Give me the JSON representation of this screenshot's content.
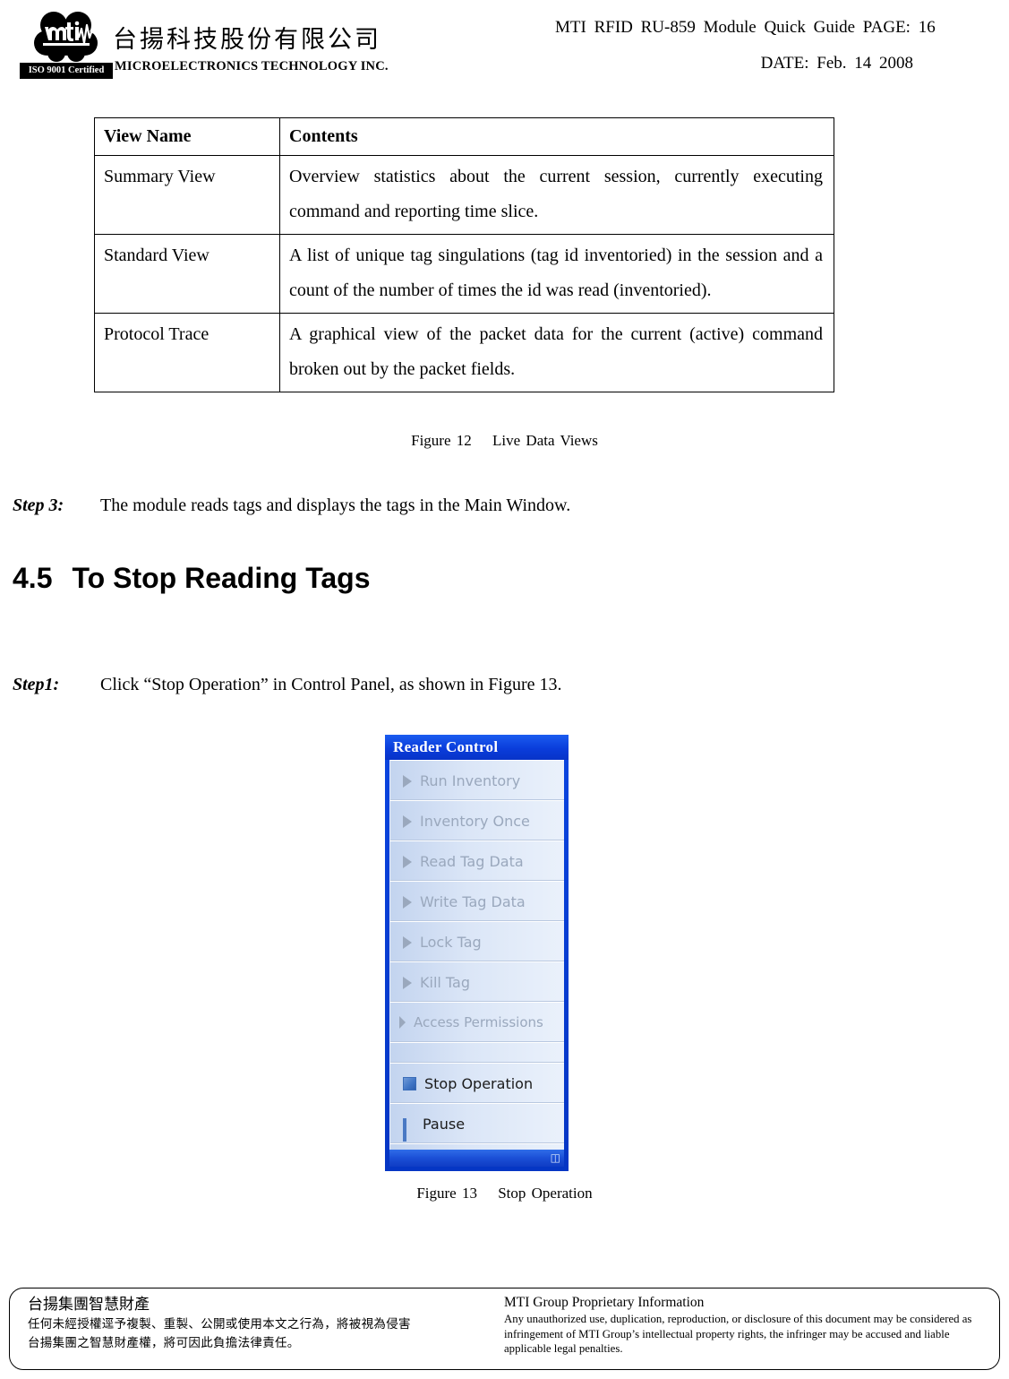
{
  "header": {
    "company_cn": "台揚科技股份有限公司",
    "company_en": "MICROELECTRONICS TECHNOLOGY INC.",
    "iso_badge": "ISO 9001 Certified",
    "doc_title": "MTI  RFID  RU-859  Module  Quick  Guide   PAGE:  16",
    "doc_date": "DATE:  Feb.  14  2008"
  },
  "views_table": {
    "headers": [
      "View Name",
      "Contents"
    ],
    "rows": [
      {
        "name": "Summary View",
        "contents": "Overview statistics about the current session, currently executing command and reporting time slice."
      },
      {
        "name": "Standard View",
        "contents": "A list of unique tag singulations (tag id inventoried) in the session and a count of the number of times the id was read (inventoried)."
      },
      {
        "name": "Protocol Trace",
        "contents": "A graphical view of the packet data for the current (active) command broken out by the packet fields."
      }
    ]
  },
  "captions": {
    "figure_12": "Figure 12　 Live Data Views",
    "figure_13": "Figure 13　 Stop Operation"
  },
  "steps": {
    "step3_label": "Step 3:",
    "step3_text": "The module reads tags and displays the tags in the Main Window.",
    "step1_label": "Step1:",
    "step1_text": "Click “Stop Operation” in Control Panel, as shown in Figure 13."
  },
  "section": {
    "number": "4.5",
    "title": "To Stop Reading Tags"
  },
  "reader_control": {
    "title": "Reader Control",
    "items": [
      {
        "label": "Run Inventory",
        "icon": "arrow-right-icon",
        "enabled": false
      },
      {
        "label": "Inventory Once",
        "icon": "arrow-right-icon",
        "enabled": false
      },
      {
        "label": "Read Tag Data",
        "icon": "arrow-right-icon",
        "enabled": false
      },
      {
        "label": "Write Tag Data",
        "icon": "arrow-right-icon",
        "enabled": false
      },
      {
        "label": "Lock Tag",
        "icon": "arrow-right-icon",
        "enabled": false
      },
      {
        "label": "Kill Tag",
        "icon": "arrow-right-icon",
        "enabled": false
      },
      {
        "label": "Access Permissions",
        "icon": "arrow-right-icon",
        "enabled": false
      },
      {
        "label": "Stop Operation",
        "icon": "stop-square-icon",
        "enabled": true
      },
      {
        "label": "Pause",
        "icon": "pause-bars-icon",
        "enabled": true
      }
    ],
    "grip_icon": "resize-grip-icon",
    "colors": {
      "titlebar": "#0a3ddb",
      "panel_border": "#0b3fd4",
      "body_gradient_start": "#c3d4ef",
      "body_gradient_end": "#eaf1fb",
      "disabled_text": "#9aa8bd",
      "enabled_text": "#1b1b1b"
    }
  },
  "footer": {
    "cn_title": "台揚集團智慧財產",
    "cn_line1": "任何未經授權逕予複製、重製、公開或使用本文之行為，將被視為侵害",
    "cn_line2": "台揚集團之智慧財產權，將可因此負擔法律責任。",
    "en_title": "MTI Group Proprietary Information",
    "en_body": "Any unauthorized use, duplication, reproduction, or disclosure of this document may be considered as infringement of MTI Group’s intellectual property rights, the infringer may be accused and liable applicable legal penalties."
  }
}
